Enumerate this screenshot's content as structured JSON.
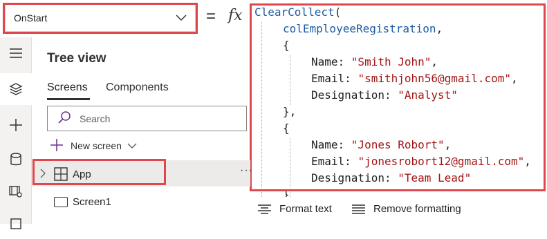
{
  "property_bar": {
    "selected_property": "OnStart",
    "equals": "=",
    "fx": "fx"
  },
  "formula": {
    "lines": [
      {
        "indent": 0,
        "parts": [
          {
            "t": "ClearCollect",
            "c": "k"
          },
          {
            "t": "(",
            "c": "p"
          }
        ]
      },
      {
        "indent": 1,
        "parts": [
          {
            "t": "colEmployeeRegistration",
            "c": "k"
          },
          {
            "t": ",",
            "c": "p"
          }
        ]
      },
      {
        "indent": 1,
        "parts": [
          {
            "t": "{",
            "c": "p"
          }
        ]
      },
      {
        "indent": 2,
        "parts": [
          {
            "t": "Name",
            "c": "p"
          },
          {
            "t": ": ",
            "c": "p"
          },
          {
            "t": "\"Smith John\"",
            "c": "s"
          },
          {
            "t": ",",
            "c": "p"
          }
        ]
      },
      {
        "indent": 2,
        "parts": [
          {
            "t": "Email",
            "c": "p"
          },
          {
            "t": ": ",
            "c": "p"
          },
          {
            "t": "\"smithjohn56@gmail.com\"",
            "c": "s"
          },
          {
            "t": ",",
            "c": "p"
          }
        ]
      },
      {
        "indent": 2,
        "parts": [
          {
            "t": "Designation",
            "c": "p"
          },
          {
            "t": ": ",
            "c": "p"
          },
          {
            "t": "\"Analyst\"",
            "c": "s"
          }
        ]
      },
      {
        "indent": 1,
        "parts": [
          {
            "t": "},",
            "c": "p"
          }
        ]
      },
      {
        "indent": 1,
        "parts": [
          {
            "t": "{",
            "c": "p"
          }
        ]
      },
      {
        "indent": 2,
        "parts": [
          {
            "t": "Name",
            "c": "p"
          },
          {
            "t": ": ",
            "c": "p"
          },
          {
            "t": "\"Jones Robort\"",
            "c": "s"
          },
          {
            "t": ",",
            "c": "p"
          }
        ]
      },
      {
        "indent": 2,
        "parts": [
          {
            "t": "Email",
            "c": "p"
          },
          {
            "t": ": ",
            "c": "p"
          },
          {
            "t": "\"jonesrobort12@gmail.com\"",
            "c": "s"
          },
          {
            "t": ",",
            "c": "p"
          }
        ]
      },
      {
        "indent": 2,
        "parts": [
          {
            "t": "Designation",
            "c": "p"
          },
          {
            "t": ": ",
            "c": "p"
          },
          {
            "t": "\"Team Lead\"",
            "c": "s"
          }
        ]
      },
      {
        "indent": 1,
        "parts": [
          {
            "t": "}",
            "c": "p"
          }
        ]
      }
    ]
  },
  "formula_toolbar": {
    "format_text": "Format text",
    "remove_formatting": "Remove formatting"
  },
  "left_rail": {
    "items": [
      "menu-icon",
      "layers-icon",
      "plus-icon",
      "database-icon",
      "media-icon"
    ]
  },
  "tree_view": {
    "title": "Tree view",
    "tabs": [
      {
        "label": "Screens",
        "active": true
      },
      {
        "label": "Components",
        "active": false
      }
    ],
    "search_placeholder": "Search",
    "new_screen_label": "New screen",
    "items": [
      {
        "label": "App",
        "more": "···"
      },
      {
        "label": "Screen1"
      }
    ]
  },
  "colors": {
    "highlight": "#e0474c",
    "keyword": "#1c5a9e",
    "string": "#a31515"
  }
}
